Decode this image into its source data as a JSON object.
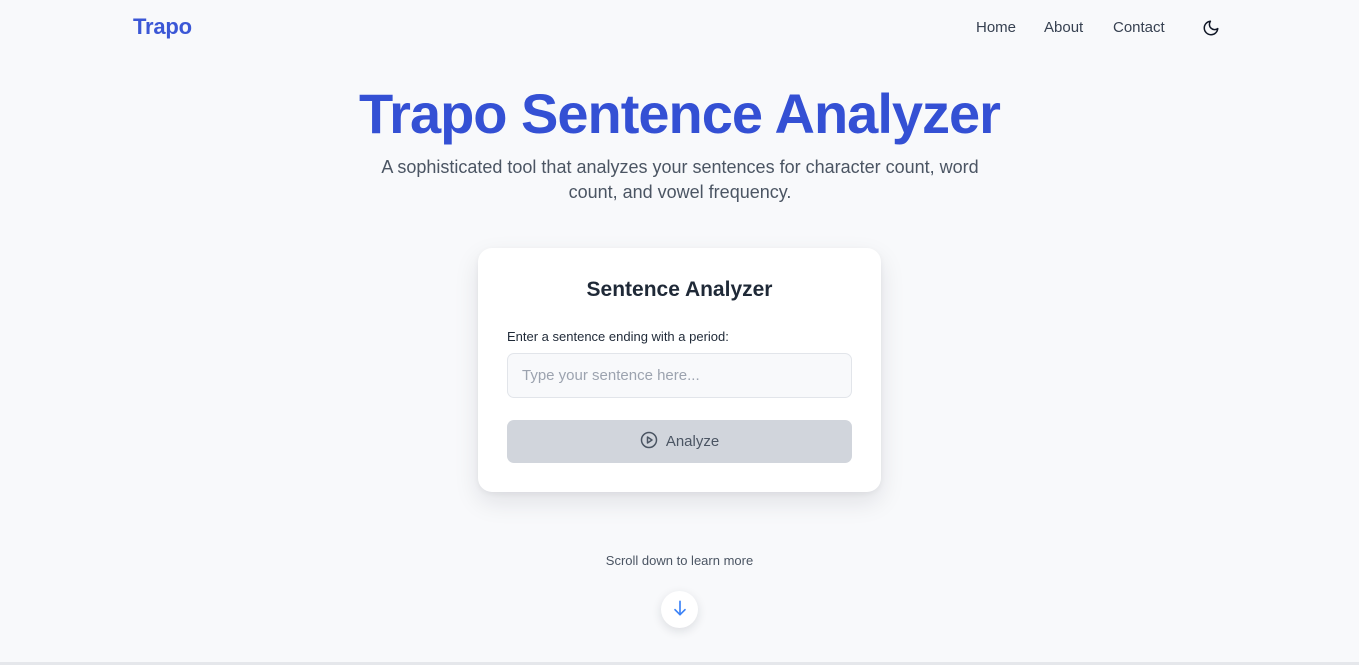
{
  "header": {
    "brand": "Trapo",
    "nav": {
      "home": "Home",
      "about": "About",
      "contact": "Contact"
    },
    "theme_icon": "moon-icon"
  },
  "hero": {
    "title": "Trapo Sentence Analyzer",
    "subtitle": "A sophisticated tool that analyzes your sentences for character count, word count, and vowel frequency."
  },
  "analyzer": {
    "title": "Sentence Analyzer",
    "label": "Enter a sentence ending with a period:",
    "input_value": "",
    "input_placeholder": "Type your sentence here...",
    "button_label": "Analyze",
    "button_icon": "play-circle-icon"
  },
  "scroll": {
    "hint": "Scroll down to learn more",
    "icon": "arrow-down-icon"
  },
  "colors": {
    "brand": "#3b57d6",
    "title": "#3450d4",
    "button_disabled": "#d1d5dc",
    "arrow": "#3b82f6"
  }
}
